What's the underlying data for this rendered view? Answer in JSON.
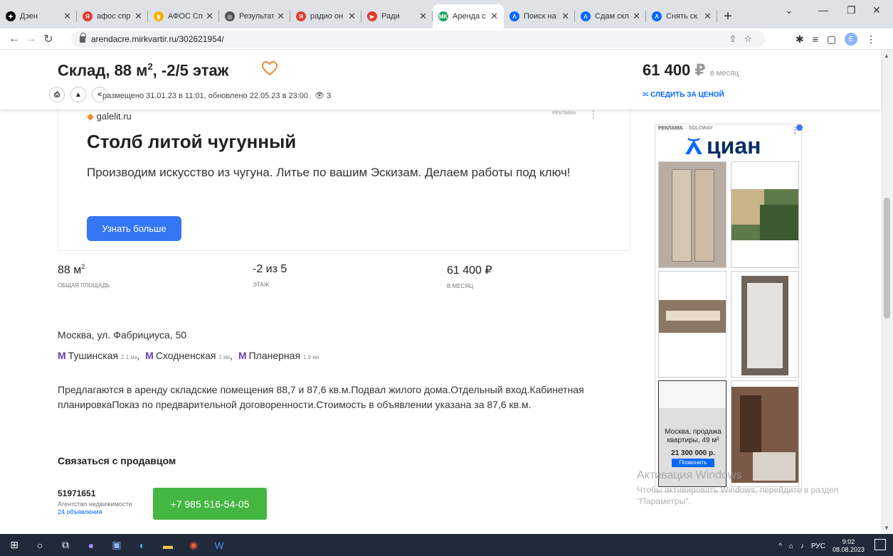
{
  "browser": {
    "tabs": [
      {
        "title": "Дзен",
        "icon_color": "#000000",
        "icon_glyph": "✚"
      },
      {
        "title": "афос спр",
        "icon_color": "#e33b2e",
        "icon_glyph": "Я"
      },
      {
        "title": "АФОС Сп",
        "icon_color": "#f4b400",
        "icon_glyph": "▮"
      },
      {
        "title": "Результат",
        "icon_color": "#555555",
        "icon_glyph": "◎"
      },
      {
        "title": "радио он",
        "icon_color": "#e33b2e",
        "icon_glyph": "Я"
      },
      {
        "title": "Ради",
        "icon_color": "#e33b2e",
        "icon_glyph": "▶"
      },
      {
        "title": "Аренда с",
        "icon_color": "#1aa260",
        "icon_glyph": "MK",
        "active": true
      },
      {
        "title": "Поиск на",
        "icon_color": "#0468ff",
        "icon_glyph": "Λ"
      },
      {
        "title": "Сдам скл",
        "icon_color": "#0468ff",
        "icon_glyph": "Λ"
      },
      {
        "title": "Снять ск",
        "icon_color": "#0468ff",
        "icon_glyph": "Λ"
      }
    ],
    "url": "arendacre.mirkvartir.ru/302621954/",
    "profile_initial": "E"
  },
  "listing": {
    "title_main": "Склад, 88 м",
    "title_sup": "2",
    "title_rest": ", -2/5 этаж",
    "meta": "размещено 31.01.23 в 11:01, обновлено 22.05.23 в 23:00",
    "views": "3",
    "price": "61 400",
    "currency": "₽",
    "price_unit": "в месяц",
    "watch_price": "Следить за ценой"
  },
  "ad": {
    "source": "galelit.ru",
    "mark": "РЕКЛАМА",
    "title": "Столб литой чугунный",
    "text": "Производим искусство из чугуна. Литье по вашим Эскизам. Делаем работы под ключ!",
    "button": "Узнать больше"
  },
  "stats": [
    {
      "value": "88 м",
      "sup": "2",
      "label": "общая площадь"
    },
    {
      "value": "-2 из 5",
      "sup": "",
      "label": "этаж"
    },
    {
      "value": "61 400 ₽",
      "sup": "",
      "label": "в месяц"
    }
  ],
  "address": "Москва, ул. Фабрициуса, 50",
  "metro": [
    {
      "name": "Тушинская",
      "distance": "2.1 км"
    },
    {
      "name": "Сходненская",
      "distance": "1 км"
    },
    {
      "name": "Планерная",
      "distance": "1.9 км"
    }
  ],
  "description": "Предлагаются в аренду складские помещения 88,7 и 87,6 кв.м.Подвал жилого дома.Отдельный вход.Кабинетная планировкаПоказ по предварительной договоренности.Стоимость в объявлении указана за 87,6 кв.м.",
  "contact": {
    "heading": "Связаться с продавцом",
    "seller_id": "51971651",
    "seller_type": "Агентство недвижимости",
    "seller_ads": "24 объявления",
    "phone": "+7 985 516-54-05"
  },
  "side_ad": {
    "mark": "РЕКЛАМА",
    "mark_source": "SOLOWAY",
    "brand": "циан",
    "overlay_text": "Москва, продажа квартиры, 49 м²",
    "overlay_price": "21 300 000 р.",
    "overlay_button": "Позвонить"
  },
  "windows_watermark": {
    "line1": "Активация Windows",
    "line2": "Чтобы активировать Windows, перейдите в раздел",
    "line3": "\"Параметры\"."
  },
  "taskbar": {
    "lang": "РУС",
    "time": "9:02",
    "date": "08.08.2023"
  },
  "colors": {
    "accent_blue": "#0468ff",
    "button_blue": "#3677f5",
    "phone_green": "#44b642",
    "metro_purple": "#6a3bb7",
    "heart_orange": "#f08c32"
  }
}
